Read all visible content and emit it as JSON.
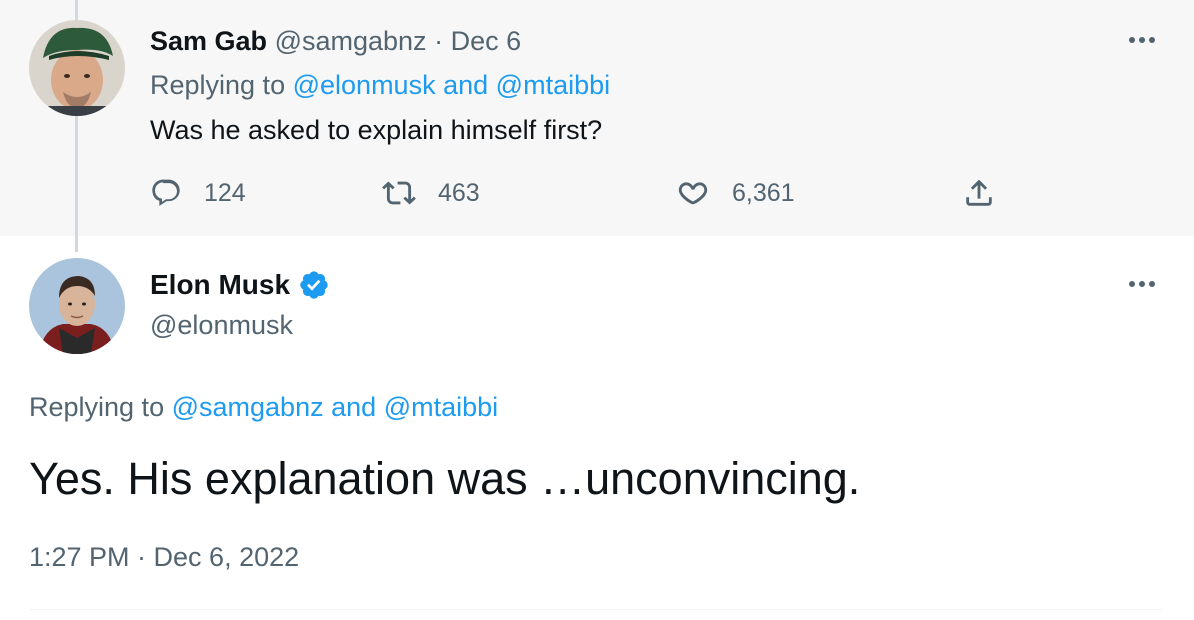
{
  "reply_tweet": {
    "author_name": "Sam Gab",
    "author_handle": "@samgabnz",
    "separator": "·",
    "date": "Dec 6",
    "replying_prefix": "Replying to",
    "replying_to_1": "@elonmusk",
    "replying_and": "and",
    "replying_to_2": "@mtaibbi",
    "text": "Was he asked to explain himself first?",
    "actions": {
      "reply_count": "124",
      "retweet_count": "463",
      "like_count": "6,361"
    }
  },
  "main_tweet": {
    "author_name": "Elon Musk",
    "author_handle": "@elonmusk",
    "replying_prefix": "Replying to",
    "replying_to_1": "@samgabnz",
    "replying_and": "and",
    "replying_to_2": "@mtaibbi",
    "text": "Yes. His explanation was …unconvincing.",
    "timestamp": "1:27 PM · Dec 6, 2022"
  },
  "icons": {
    "reply": "reply-icon",
    "retweet": "retweet-icon",
    "like": "heart-icon",
    "share": "share-icon",
    "more": "more-icon",
    "verified": "verified-badge-icon"
  },
  "colors": {
    "link": "#1d9bf0",
    "muted": "#536471",
    "text": "#0f1419",
    "reply_background": "#f7f7f7"
  }
}
